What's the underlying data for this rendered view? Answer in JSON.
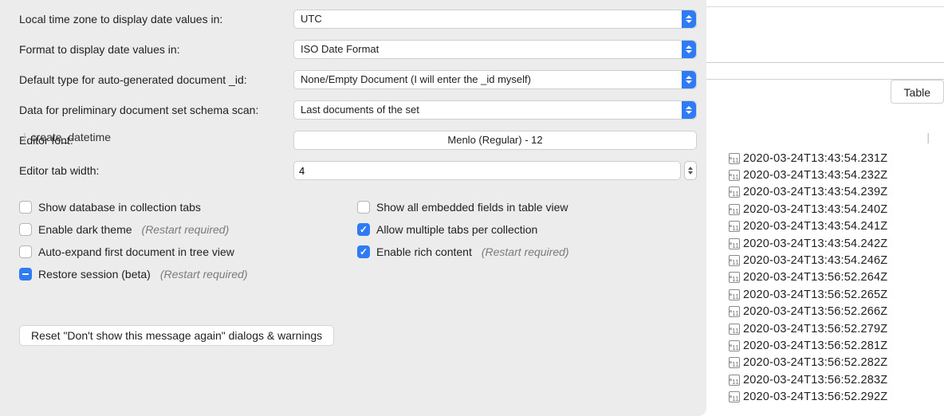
{
  "prefs": {
    "timezone": {
      "label": "Local time zone to display date values in:",
      "value": "UTC"
    },
    "format": {
      "label": "Format to display date values in:",
      "value": "ISO Date Format"
    },
    "default_id": {
      "label": "Default type for auto-generated document _id:",
      "value": "None/Empty Document (I will enter the _id myself)"
    },
    "schema_scan": {
      "label": "Data for preliminary document set schema scan:",
      "value": "Last documents of the set"
    },
    "font": {
      "label": "Editor font:",
      "value": "Menlo (Regular) - 12"
    },
    "tab_width": {
      "label": "Editor tab width:",
      "value": "4"
    }
  },
  "restart_hint": "(Restart required)",
  "checks_left": [
    {
      "id": "show-db-in-tabs",
      "label": "Show database in collection tabs",
      "checked": false,
      "restart": false
    },
    {
      "id": "dark-theme",
      "label": "Enable dark theme",
      "checked": false,
      "restart": true
    },
    {
      "id": "auto-expand",
      "label": "Auto-expand first document in tree view",
      "checked": false,
      "restart": false
    },
    {
      "id": "restore-session",
      "label": "Restore session (beta)",
      "checked": "mixed",
      "restart": true
    }
  ],
  "checks_right": [
    {
      "id": "show-embedded",
      "label": "Show all embedded fields in table view",
      "checked": false,
      "restart": false
    },
    {
      "id": "multi-tabs",
      "label": "Allow multiple tabs per collection",
      "checked": true,
      "restart": false
    },
    {
      "id": "rich-content",
      "label": "Enable rich content",
      "checked": true,
      "restart": true
    }
  ],
  "reset_button": "Reset \"Don't show this message again\" dialogs & warnings",
  "table_tab": "Table",
  "column": {
    "header": "create_datetime",
    "icon_day": "11"
  },
  "dates": [
    "2020-03-24T13:43:54.231Z",
    "2020-03-24T13:43:54.232Z",
    "2020-03-24T13:43:54.239Z",
    "2020-03-24T13:43:54.240Z",
    "2020-03-24T13:43:54.241Z",
    "2020-03-24T13:43:54.242Z",
    "2020-03-24T13:43:54.246Z",
    "2020-03-24T13:56:52.264Z",
    "2020-03-24T13:56:52.265Z",
    "2020-03-24T13:56:52.266Z",
    "2020-03-24T13:56:52.279Z",
    "2020-03-24T13:56:52.281Z",
    "2020-03-24T13:56:52.282Z",
    "2020-03-24T13:56:52.283Z",
    "2020-03-24T13:56:52.292Z"
  ]
}
